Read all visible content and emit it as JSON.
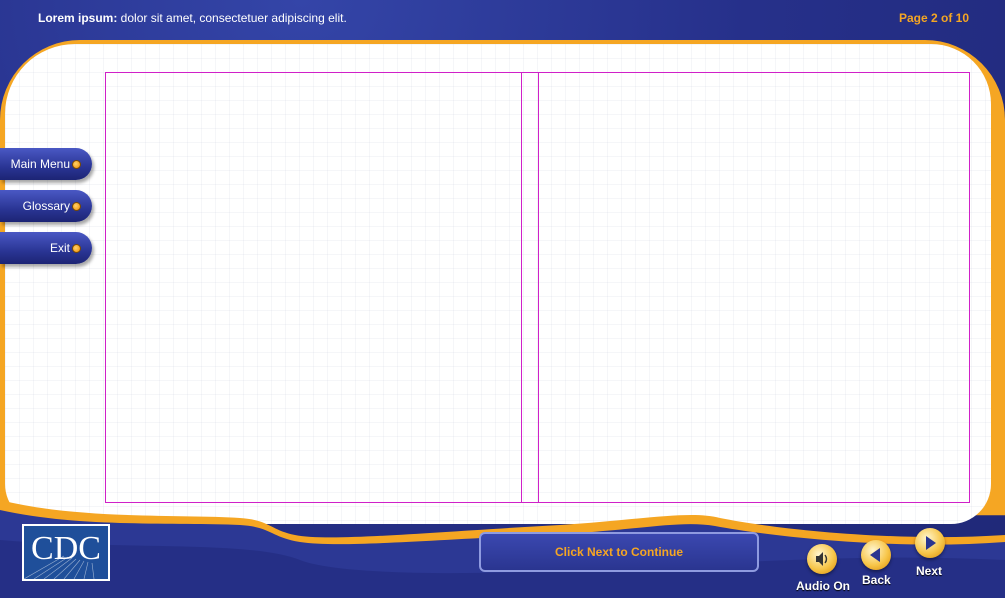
{
  "header": {
    "title_bold": "Lorem ipsum:",
    "title_rest": " dolor sit amet, consectetuer adipiscing elit.",
    "page_indicator": "Page 2 of 10"
  },
  "side_nav": [
    {
      "label": "Main Menu"
    },
    {
      "label": "Glossary"
    },
    {
      "label": "Exit"
    }
  ],
  "footer": {
    "continue_text": "Click Next to Continue",
    "logo_text": "CDC",
    "controls": {
      "audio_label": "Audio On",
      "back_label": "Back",
      "next_label": "Next"
    }
  },
  "colors": {
    "accent_orange": "#f5a623",
    "navy": "#2a3590",
    "content_border": "#d020c8"
  }
}
